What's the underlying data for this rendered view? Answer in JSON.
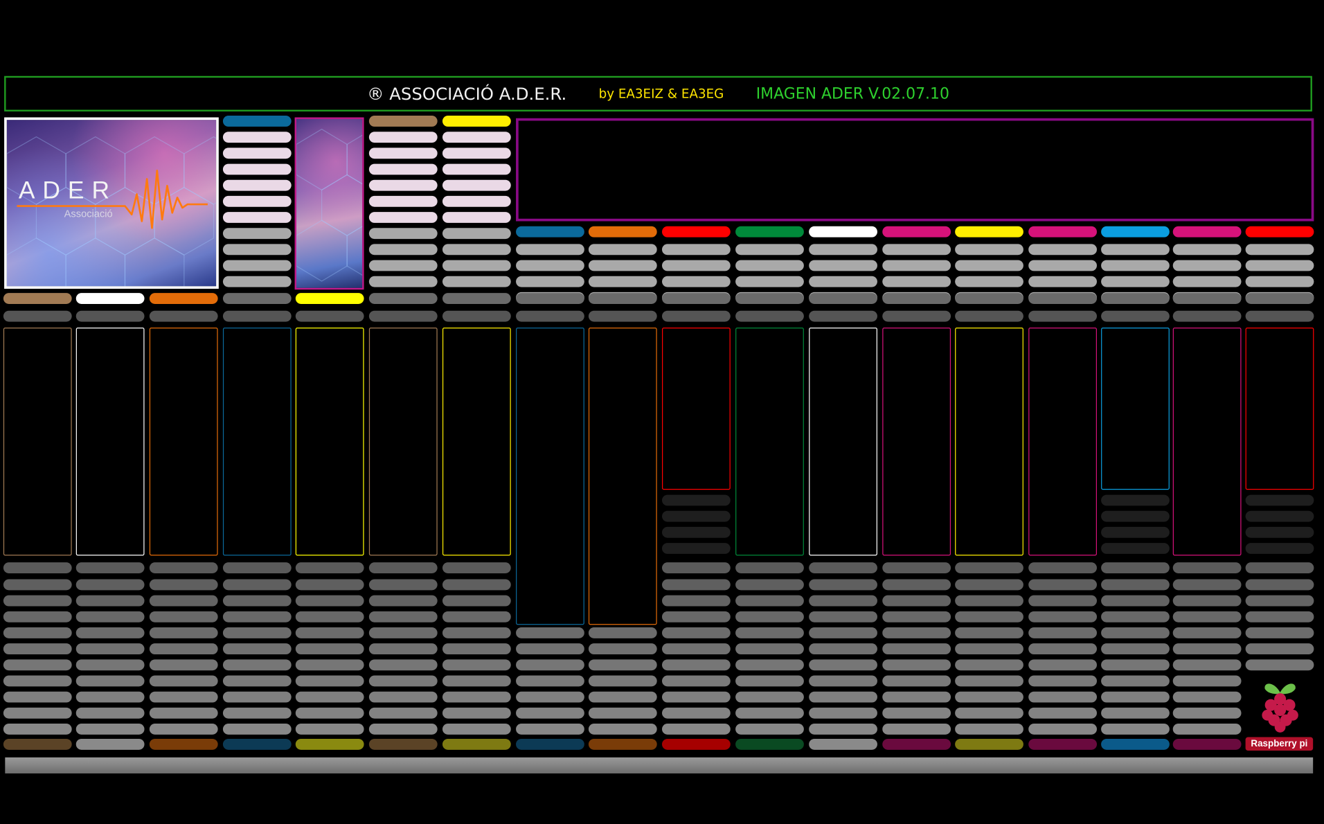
{
  "header": {
    "title": "® ASSOCIACIÓ A.D.E.R.",
    "byline": "by EA3EIZ & EA3EG",
    "version": "IMAGEN ADER V.02.07.10"
  },
  "logo": {
    "wordmark": "ADER",
    "subtitle": "Associació"
  },
  "brand": {
    "raspberry_label": "Raspberry pi"
  },
  "colors": {
    "header_border": "#1f9a1f",
    "title": "#f2f2f2",
    "byline": "#ffe600",
    "version": "#2ed12e",
    "display_border": "#8a0a86",
    "light_key": "#ead9e6",
    "gray_key": "#a9a9a9",
    "dark_key": "#555555",
    "raspberry_red": "#c51a4a",
    "raspberry_leaf": "#6cc04a"
  },
  "channels": [
    {
      "accent": "#a27b54",
      "dim": "#5b4326"
    },
    {
      "accent": "#ffffff",
      "dim": "#8a8a8a"
    },
    {
      "accent": "#e36c09",
      "dim": "#7a3c08"
    },
    {
      "accent": "#0b6a9c",
      "dim": "#0c3a55"
    },
    {
      "accent": "#ffff00",
      "dim": "#8a8a10"
    },
    {
      "accent": "#a27b54",
      "dim": "#5b4326"
    },
    {
      "accent": "#ffee00",
      "dim": "#7e7a12"
    },
    {
      "accent": "#0b6a9c",
      "dim": "#0c3a55"
    },
    {
      "accent": "#e36c09",
      "dim": "#7a3c08"
    },
    {
      "accent": "#ff0000",
      "dim": "#a60000"
    },
    {
      "accent": "#008a3a",
      "dim": "#0a4a22"
    },
    {
      "accent": "#ffffff",
      "dim": "#8a8a8a"
    },
    {
      "accent": "#d6127a",
      "dim": "#6a0a3e"
    },
    {
      "accent": "#ffee00",
      "dim": "#7e7a12"
    },
    {
      "accent": "#d6127a",
      "dim": "#6a0a3e"
    },
    {
      "accent": "#0b9ee0",
      "dim": "#0b5a8a"
    },
    {
      "accent": "#d6127a",
      "dim": "#6a0a3e"
    },
    {
      "accent": "#ff0000",
      "dim": "#a60000"
    }
  ]
}
